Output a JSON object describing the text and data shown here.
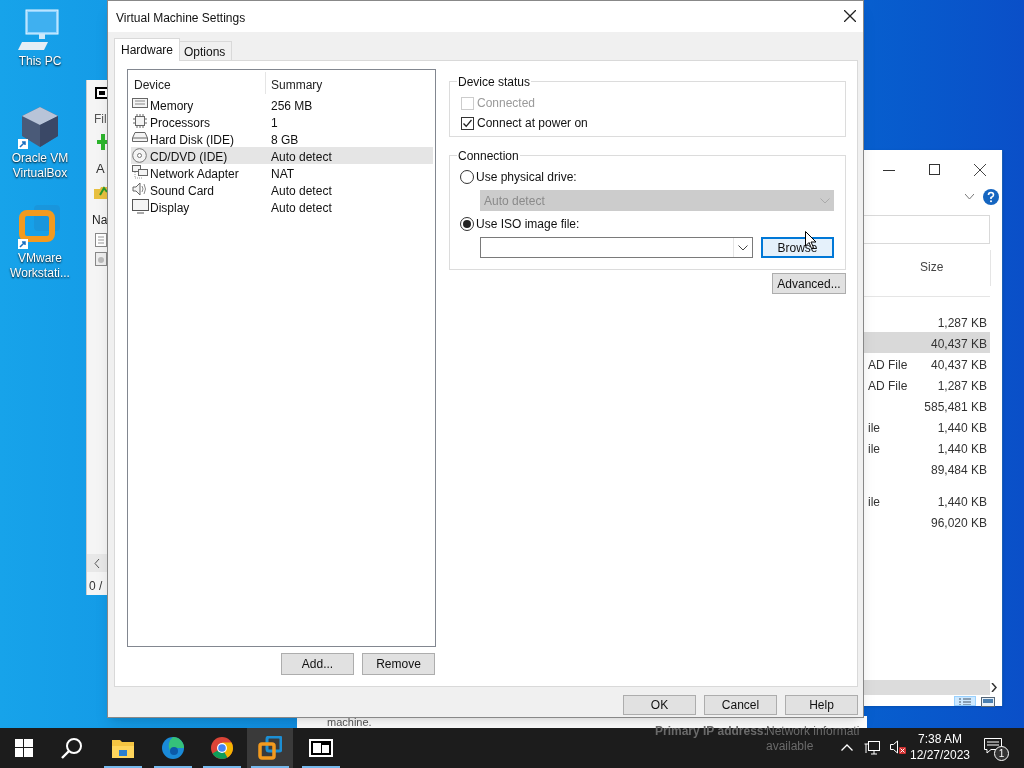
{
  "desktop_icons": [
    {
      "kind": "computer",
      "label": "This PC"
    },
    {
      "kind": "virtualbox",
      "label": "Oracle VM VirtualBox"
    },
    {
      "kind": "vmware",
      "label": "VMware Workstati..."
    }
  ],
  "archive_window": {
    "menu_text": "Fil",
    "toolbar_text": "A",
    "column_text": "Na",
    "status_text": "0 /"
  },
  "explorer_window": {
    "column_header": "Size",
    "rows": [
      {
        "type": "",
        "size": "1,287 KB",
        "selected": false
      },
      {
        "type": "",
        "size": "40,437 KB",
        "selected": true
      },
      {
        "type": "AD File",
        "size": "40,437 KB",
        "selected": false
      },
      {
        "type": "AD File",
        "size": "1,287 KB",
        "selected": false
      },
      {
        "type": "",
        "size": "585,481 KB",
        "selected": false
      },
      {
        "type": "ile",
        "size": "1,440 KB",
        "selected": false
      },
      {
        "type": "ile",
        "size": "1,440 KB",
        "selected": false
      },
      {
        "type": "",
        "size": "89,484 KB",
        "selected": false
      },
      {
        "type": "ile",
        "size": "1,440 KB",
        "selected": false
      },
      {
        "type": "",
        "size": "96,020 KB",
        "selected": false
      }
    ]
  },
  "background_texts": {
    "note": "machine.",
    "ip_label": "Primary IP address:",
    "ip_value": "Network informati",
    "ip_value_2": "available"
  },
  "dialog": {
    "title": "Virtual Machine Settings",
    "tabs": [
      {
        "label": "Hardware",
        "selected": true
      },
      {
        "label": "Options",
        "selected": false
      }
    ],
    "device_columns": [
      "Device",
      "Summary"
    ],
    "devices": [
      {
        "kind": "memory",
        "name": "Memory",
        "summary": "256 MB",
        "selected": false
      },
      {
        "kind": "processor",
        "name": "Processors",
        "summary": "1",
        "selected": false
      },
      {
        "kind": "disk",
        "name": "Hard Disk (IDE)",
        "summary": "8 GB",
        "selected": false
      },
      {
        "kind": "cd",
        "name": "CD/DVD (IDE)",
        "summary": "Auto detect",
        "selected": true
      },
      {
        "kind": "network",
        "name": "Network Adapter",
        "summary": "NAT",
        "selected": false
      },
      {
        "kind": "sound",
        "name": "Sound Card",
        "summary": "Auto detect",
        "selected": false
      },
      {
        "kind": "display",
        "name": "Display",
        "summary": "Auto detect",
        "selected": false
      }
    ],
    "list_buttons": [
      "Add...",
      "Remove"
    ],
    "device_status": {
      "label": "Device status",
      "options": [
        {
          "label": "Connected",
          "checked": false,
          "disabled": true
        },
        {
          "label": "Connect at power on",
          "checked": true,
          "disabled": false
        }
      ]
    },
    "connection": {
      "label": "Connection",
      "physical": {
        "label": "Use physical drive:",
        "selected": false
      },
      "drive_dropdown": {
        "value": "Auto detect",
        "disabled": true
      },
      "iso": {
        "label": "Use ISO image file:",
        "selected": true
      },
      "browse_button": "Browse",
      "advanced_button": "Advanced..."
    },
    "footer_buttons": [
      "OK",
      "Cancel",
      "Help"
    ]
  },
  "taskbar": {
    "apps": [
      {
        "kind": "explorer",
        "active": false
      },
      {
        "kind": "edge",
        "active": false
      },
      {
        "kind": "chrome",
        "active": false
      },
      {
        "kind": "vmware",
        "active": true
      },
      {
        "kind": "archiver",
        "active": false
      }
    ],
    "time": "7:38 AM",
    "date": "12/27/2023",
    "notification_count": "1"
  }
}
